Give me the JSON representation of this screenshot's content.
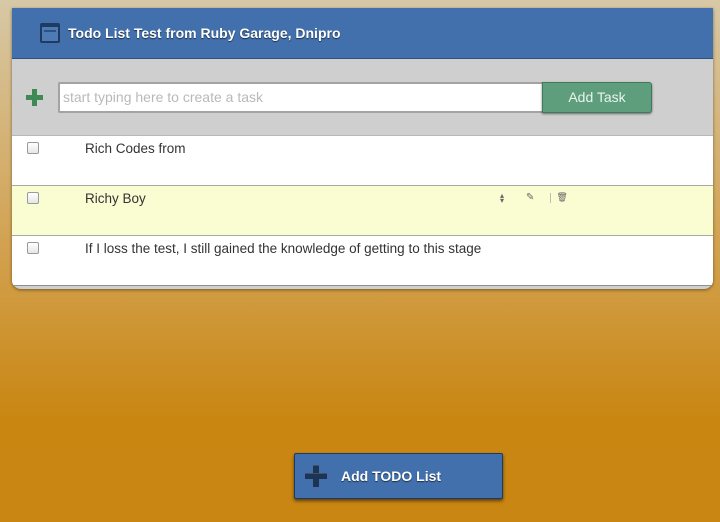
{
  "project": {
    "title": "Todo List Test from Ruby Garage, Dnipro",
    "icon": "calendar-icon"
  },
  "new_task": {
    "placeholder": "start typing here to create a task",
    "value": "",
    "button_label": "Add Task",
    "icon": "plus-icon"
  },
  "tasks": [
    {
      "text": "Rich Codes from",
      "done": false
    },
    {
      "text": "Richy Boy",
      "done": false,
      "highlighted": true,
      "actions": [
        "sort-icon",
        "edit-icon",
        "trash-icon"
      ]
    },
    {
      "text": "If I loss the test, I still gained the knowledge of getting to this stage",
      "done": false
    }
  ],
  "footer": {
    "add_list_label": "Add TODO List",
    "icon": "plus-icon"
  },
  "colors": {
    "header_blue": "#4270ac",
    "add_button_green": "#5e9e7c",
    "highlight_row": "#fafcd2",
    "background_top": "#d7c8a6",
    "background_bottom": "#c98611"
  }
}
